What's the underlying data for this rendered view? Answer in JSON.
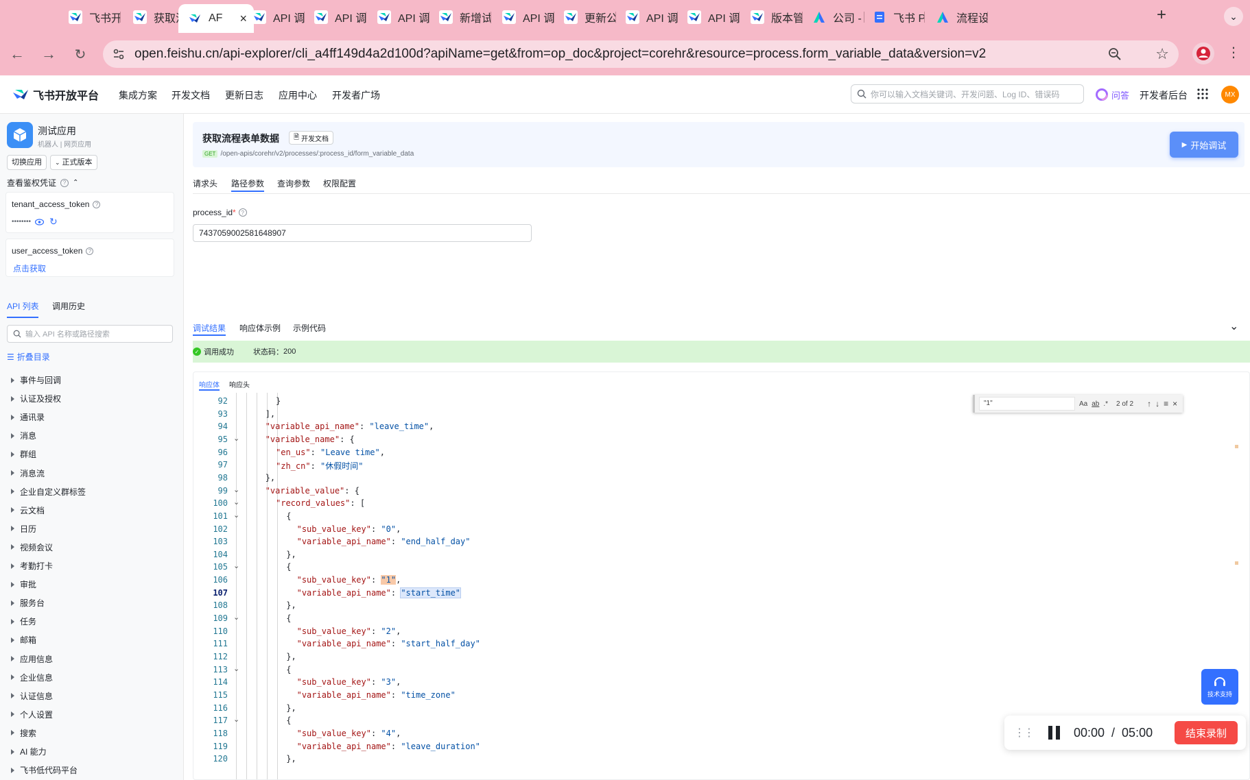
{
  "browser": {
    "tabs": [
      {
        "title": "飞书开",
        "icon": "feishu"
      },
      {
        "title": "获取流",
        "icon": "feishu"
      },
      {
        "title": "AF",
        "icon": "feishu",
        "active": true
      },
      {
        "title": "API 调",
        "icon": "feishu"
      },
      {
        "title": "API 调",
        "icon": "feishu"
      },
      {
        "title": "API 调",
        "icon": "feishu"
      },
      {
        "title": "新增试",
        "icon": "feishu"
      },
      {
        "title": "API 调",
        "icon": "feishu"
      },
      {
        "title": "更新公",
        "icon": "feishu"
      },
      {
        "title": "API 调",
        "icon": "feishu"
      },
      {
        "title": "API 调",
        "icon": "feishu"
      },
      {
        "title": "版本管",
        "icon": "feishu"
      },
      {
        "title": "公司 -",
        "icon": "lark-people"
      },
      {
        "title": "飞书 P",
        "icon": "doc"
      },
      {
        "title": "流程设",
        "icon": "lark-people"
      }
    ],
    "new_tab": "+",
    "url": "open.feishu.cn/api-explorer/cli_a4ff149d4a2d100d?apiName=get&from=op_doc&project=corehr&resource=process.form_variable_data&version=v2"
  },
  "header": {
    "logo_text": "飞书开放平台",
    "nav": [
      "集成方案",
      "开发文档",
      "更新日志",
      "应用中心",
      "开发者广场"
    ],
    "search_placeholder": "你可以输入文档关键词、开发问题、Log ID、错误码",
    "ask_label": "问答",
    "dev_console": "开发者后台",
    "avatar_initials": "MX"
  },
  "sidebar": {
    "app_name": "测试应用",
    "app_sub": "机器人 | 网页应用",
    "switch_app": "切换应用",
    "version": "正式版本",
    "auth_title": "查看鉴权凭证",
    "tenant_token_label": "tenant_access_token",
    "tenant_token_value": "••••••••",
    "user_token_label": "user_access_token",
    "user_token_action": "点击获取",
    "tabs": [
      "API 列表",
      "调用历史"
    ],
    "api_search_placeholder": "输入 API 名称或路径搜索",
    "collapse": "折叠目录",
    "categories": [
      "事件与回调",
      "认证及授权",
      "通讯录",
      "消息",
      "群组",
      "消息流",
      "企业自定义群标签",
      "云文档",
      "日历",
      "视频会议",
      "考勤打卡",
      "审批",
      "服务台",
      "任务",
      "邮箱",
      "应用信息",
      "企业信息",
      "认证信息",
      "个人设置",
      "搜索",
      "AI 能力",
      "飞书低代码平台"
    ]
  },
  "main": {
    "api_title": "获取流程表单数据",
    "doc_link": "开发文档",
    "method": "GET",
    "path": "/open-apis/corehr/v2/processes/:process_id/form_variable_data",
    "start_debug": "开始调试",
    "req_tabs": [
      "请求头",
      "路径参数",
      "查询参数",
      "权限配置"
    ],
    "param_label": "process_id",
    "param_required": "*",
    "param_value": "7437059002581648907",
    "result_tabs": [
      "调试结果",
      "响应体示例",
      "示例代码"
    ],
    "status_ok": "调用成功",
    "status_code_label": "状态码：",
    "status_code": "200",
    "resp_tabs": [
      "响应体",
      "响应头"
    ],
    "find": {
      "query": "\"1\"",
      "aa": "Aa",
      "ab": "ab",
      "regex": ".*",
      "count": "2 of 2"
    },
    "code_lines": [
      {
        "n": "92",
        "indent": 4,
        "text": "}"
      },
      {
        "n": "93",
        "indent": 3,
        "text": "],"
      },
      {
        "n": "94",
        "indent": 3,
        "key": "\"variable_api_name\"",
        "val": "\"leave_time\"",
        "tail": ","
      },
      {
        "n": "95",
        "indent": 3,
        "key": "\"variable_name\"",
        "val": "{",
        "fold": true
      },
      {
        "n": "96",
        "indent": 4,
        "key": "\"en_us\"",
        "val": "\"Leave time\"",
        "tail": ","
      },
      {
        "n": "97",
        "indent": 4,
        "key": "\"zh_cn\"",
        "val": "\"休假时间\""
      },
      {
        "n": "98",
        "indent": 3,
        "text": "},"
      },
      {
        "n": "99",
        "indent": 3,
        "key": "\"variable_value\"",
        "val": "{",
        "fold": true
      },
      {
        "n": "100",
        "indent": 4,
        "key": "\"record_values\"",
        "val": "[",
        "fold": true
      },
      {
        "n": "101",
        "indent": 5,
        "text": "{",
        "fold": true
      },
      {
        "n": "102",
        "indent": 6,
        "key": "\"sub_value_key\"",
        "val": "\"0\"",
        "tail": ","
      },
      {
        "n": "103",
        "indent": 6,
        "key": "\"variable_api_name\"",
        "val": "\"end_half_day\""
      },
      {
        "n": "104",
        "indent": 5,
        "text": "},"
      },
      {
        "n": "105",
        "indent": 5,
        "text": "{",
        "fold": true
      },
      {
        "n": "106",
        "indent": 6,
        "key": "\"sub_value_key\"",
        "val": "\"1\"",
        "tail": ",",
        "hl": "find"
      },
      {
        "n": "107",
        "indent": 6,
        "key": "\"variable_api_name\"",
        "val": "\"start_time\"",
        "hl": "sel",
        "current": true
      },
      {
        "n": "108",
        "indent": 5,
        "text": "},"
      },
      {
        "n": "109",
        "indent": 5,
        "text": "{",
        "fold": true
      },
      {
        "n": "110",
        "indent": 6,
        "key": "\"sub_value_key\"",
        "val": "\"2\"",
        "tail": ","
      },
      {
        "n": "111",
        "indent": 6,
        "key": "\"variable_api_name\"",
        "val": "\"start_half_day\""
      },
      {
        "n": "112",
        "indent": 5,
        "text": "},"
      },
      {
        "n": "113",
        "indent": 5,
        "text": "{",
        "fold": true
      },
      {
        "n": "114",
        "indent": 6,
        "key": "\"sub_value_key\"",
        "val": "\"3\"",
        "tail": ","
      },
      {
        "n": "115",
        "indent": 6,
        "key": "\"variable_api_name\"",
        "val": "\"time_zone\""
      },
      {
        "n": "116",
        "indent": 5,
        "text": "},"
      },
      {
        "n": "117",
        "indent": 5,
        "text": "{",
        "fold": true
      },
      {
        "n": "118",
        "indent": 6,
        "key": "\"sub_value_key\"",
        "val": "\"4\"",
        "tail": ","
      },
      {
        "n": "119",
        "indent": 6,
        "key": "\"variable_api_name\"",
        "val": "\"leave_duration\""
      },
      {
        "n": "120",
        "indent": 5,
        "text": "},"
      }
    ],
    "support_label": "技术支持",
    "recorder": {
      "time": "00:00  /  05:00",
      "stop": "结束录制"
    }
  },
  "colors": {
    "tab_strip": "#f6b9c8",
    "accent": "#3370ff",
    "success_bg": "#d9f5d6",
    "success": "#34c724",
    "stop_button": "#f54a45"
  }
}
